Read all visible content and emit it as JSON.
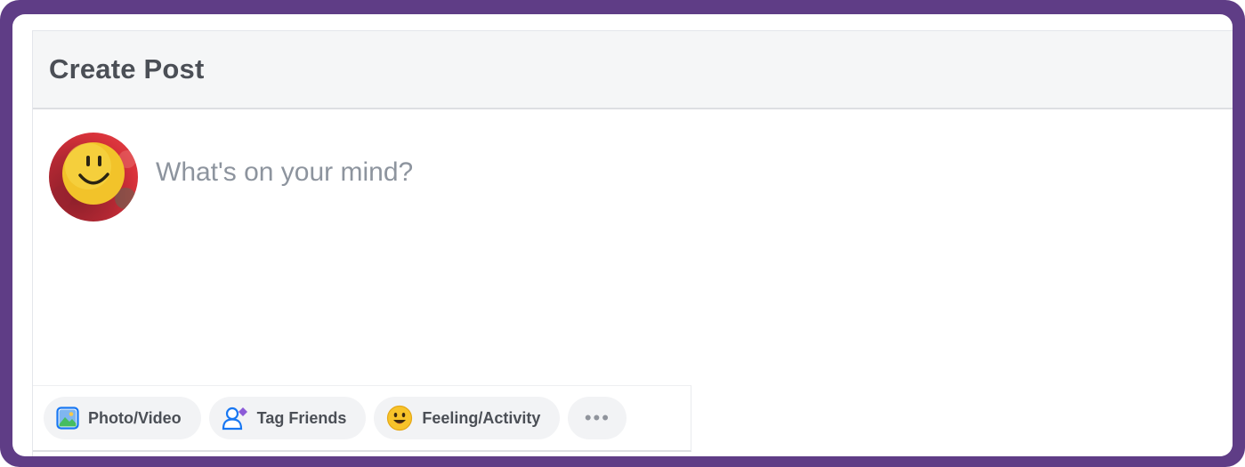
{
  "post_dialog": {
    "title": "Create Post",
    "composer": {
      "placeholder": "What's on your mind?"
    },
    "actions": [
      {
        "label": "Photo/Video",
        "icon": "photo-icon"
      },
      {
        "label": "Tag Friends",
        "icon": "tag-friends-icon"
      },
      {
        "label": "Feeling/Activity",
        "icon": "feeling-emoji-icon"
      },
      {
        "label": "•••",
        "icon": "more-icon"
      }
    ]
  },
  "colors": {
    "frame": "#5f3d86",
    "header_bg": "#f5f6f7",
    "text": "#4b4f56",
    "placeholder": "#8d949e",
    "button_bg": "#f2f3f5"
  }
}
